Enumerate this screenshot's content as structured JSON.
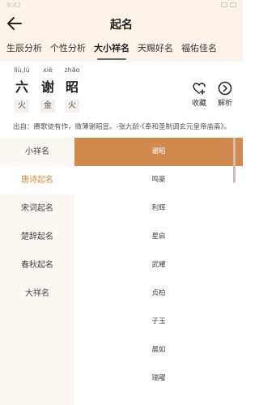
{
  "header": {
    "title": "起名",
    "status_time": "9:42"
  },
  "tabs": [
    {
      "label": "生辰分析"
    },
    {
      "label": "个性分析"
    },
    {
      "label": "大小祥名"
    },
    {
      "label": "天赐好名"
    },
    {
      "label": "福佑佳名"
    }
  ],
  "active_tab": 2,
  "name": {
    "chars": [
      {
        "pinyin": "liù,lù",
        "han": "六",
        "element": "火"
      },
      {
        "pinyin": "xiè",
        "han": "谢",
        "element": "金"
      },
      {
        "pinyin": "zhāo",
        "han": "昭",
        "element": "火"
      }
    ]
  },
  "actions": {
    "favorite": "收藏",
    "analyze": "解析"
  },
  "source_text": "出自：赓歌徒有作，微薄谢昭宣。-张九龄·《奉和圣制调玄元皇帝庙斋》。",
  "categories": [
    "小祥名",
    "唐诗起名",
    "宋词起名",
    "楚辞起名",
    "春秋起名",
    "大祥名"
  ],
  "active_category": 1,
  "names": [
    "谢昭",
    "鸣豪",
    "利辉",
    "星启",
    "武耀",
    "贞柏",
    "子玉",
    "晨如",
    "瑞曜"
  ],
  "active_name": 0,
  "colors": {
    "accent": "#d08a4f",
    "highlight_text": "#d98a3d",
    "header_bg": "#fbf3ea"
  }
}
